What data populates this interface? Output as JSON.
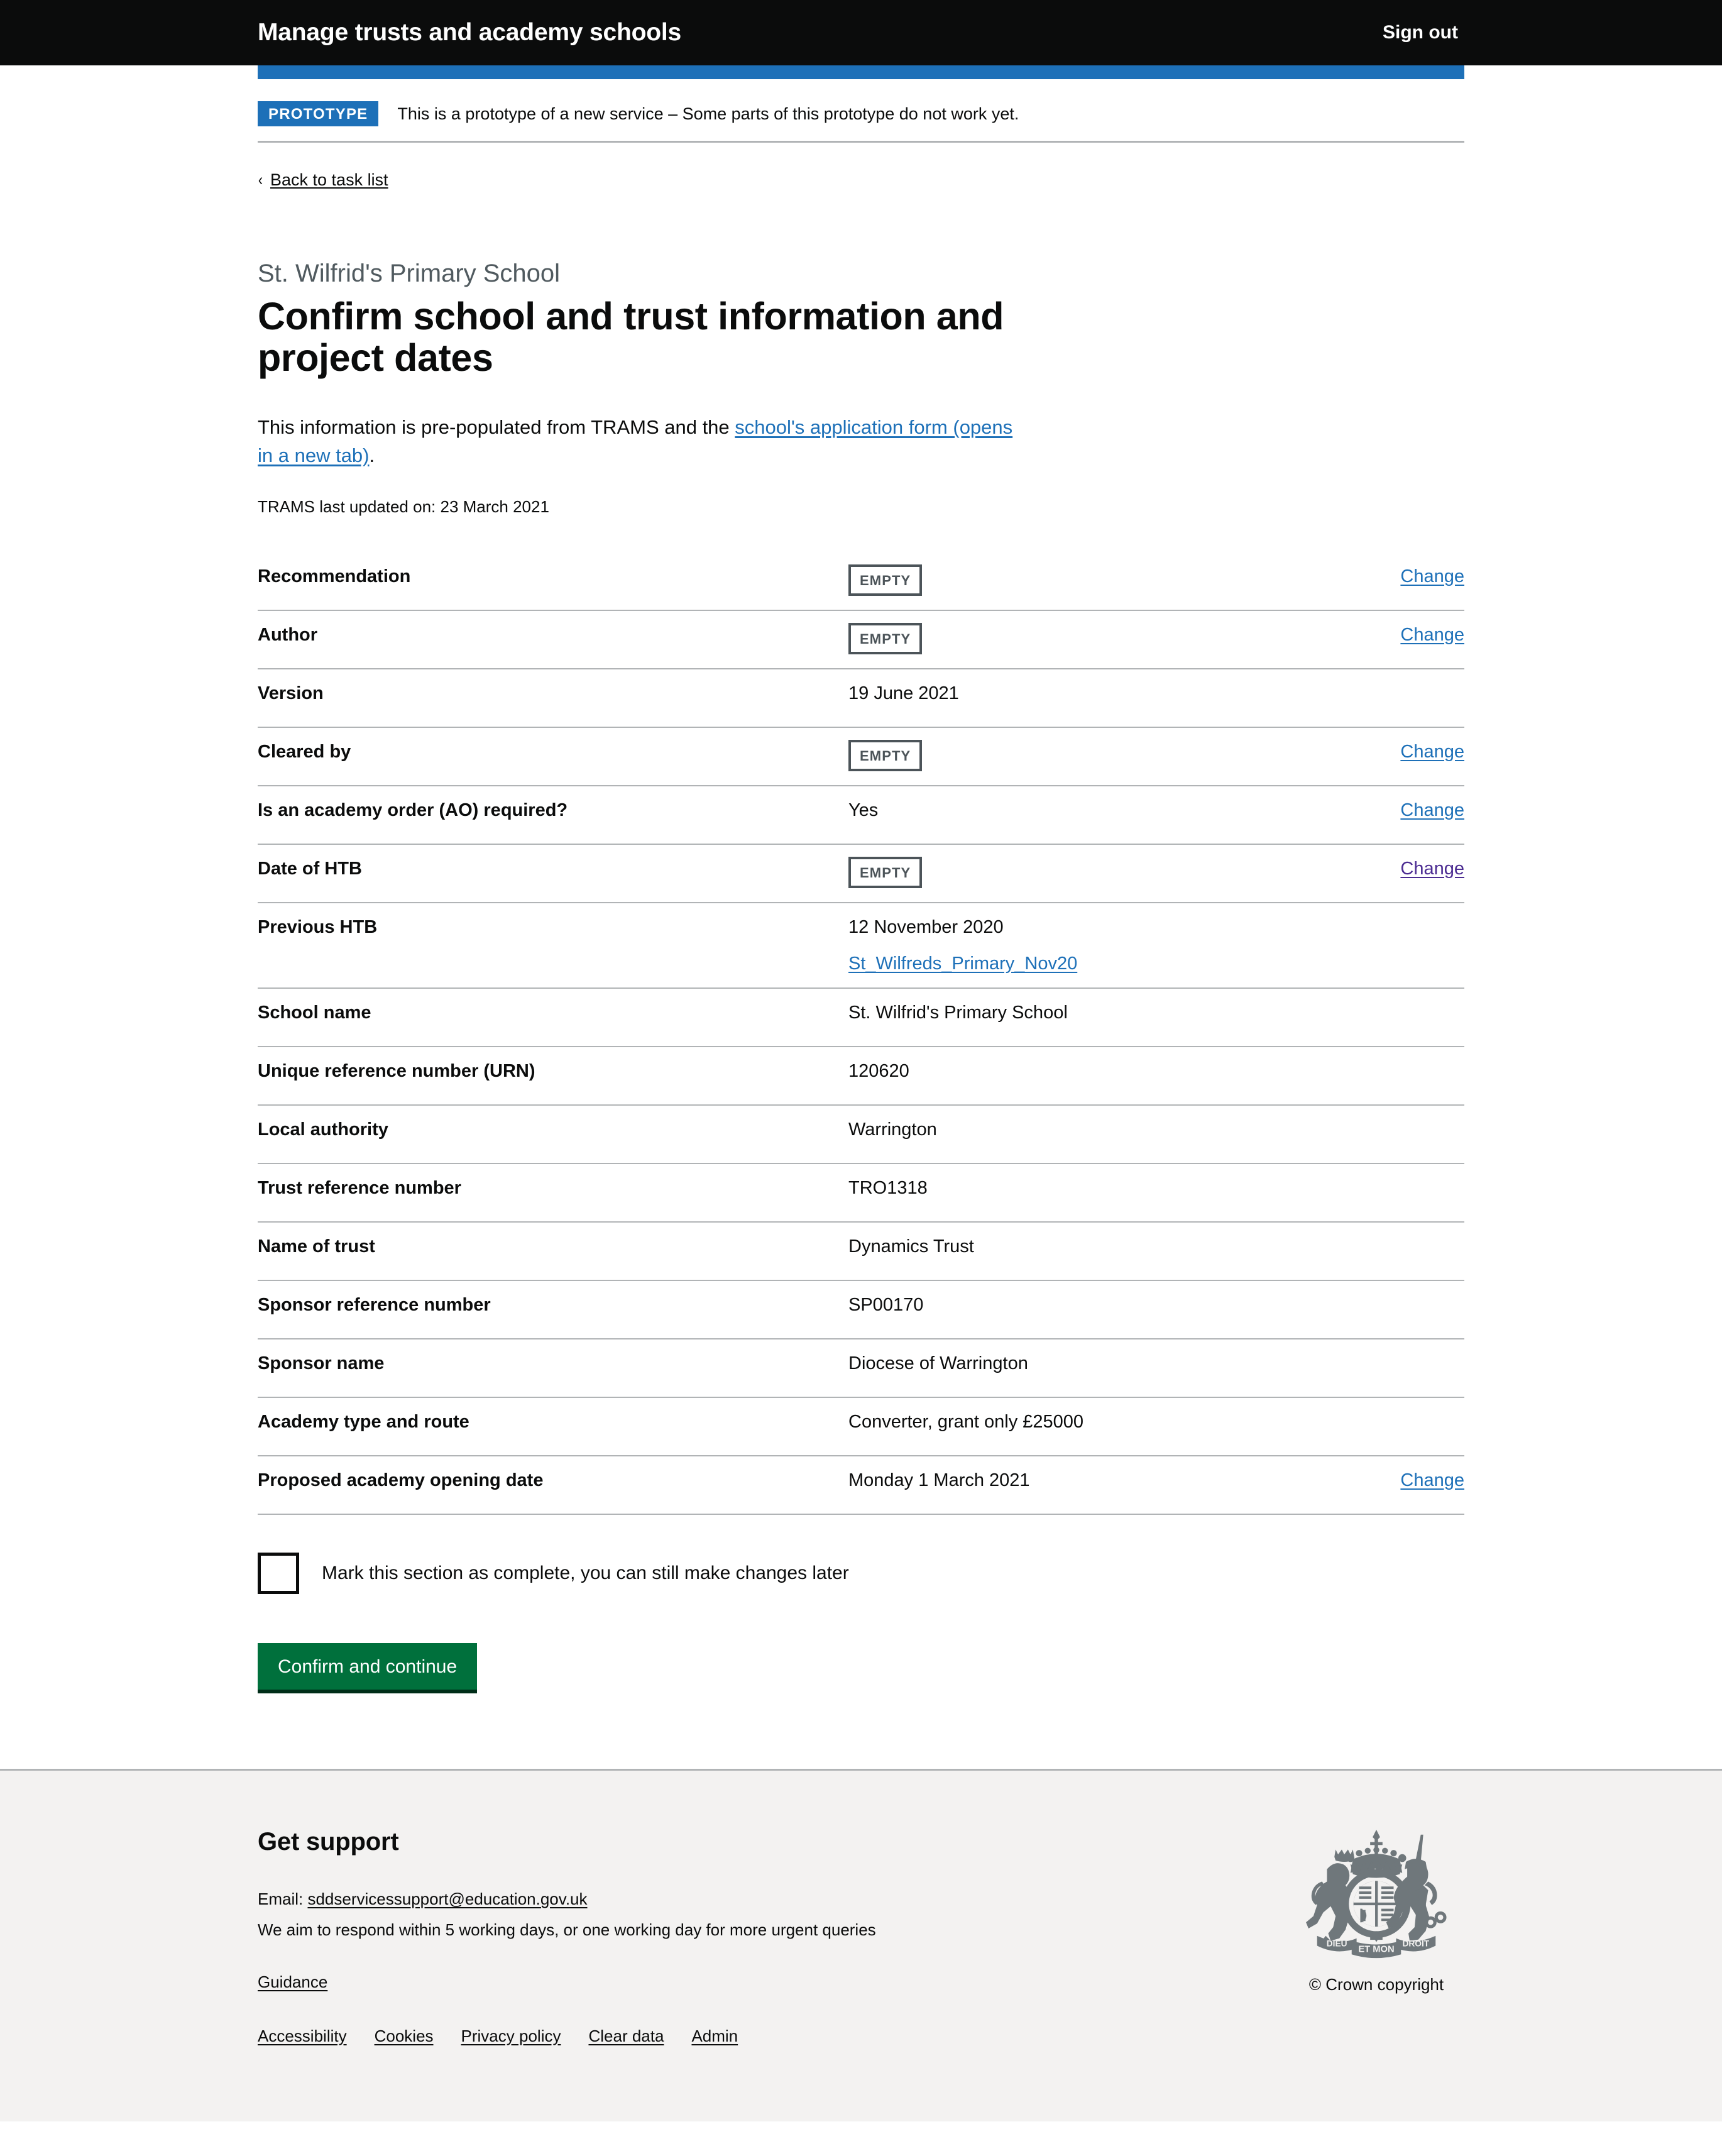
{
  "header": {
    "service_name": "Manage trusts and academy schools",
    "sign_out_label": "Sign out"
  },
  "phase_banner": {
    "tag": "PROTOTYPE",
    "text": "This is a prototype of a new service – Some parts of this prototype do not work yet."
  },
  "back_link": {
    "label": "Back to task list",
    "chevron": "chevron-left-icon"
  },
  "page": {
    "caption": "St. Wilfrid's Primary School",
    "title": "Confirm school and trust information and project dates",
    "lede_prefix": "This information is pre-populated from TRAMS and the ",
    "lede_link": "school's application form (opens in a new tab)",
    "lede_suffix": ".",
    "trams_updated": "TRAMS last updated on: 23 March 2021"
  },
  "summary_list": {
    "empty_tag_label": "EMPTY",
    "change_label": "Change",
    "rows": [
      {
        "key": "Recommendation",
        "value": "",
        "empty": true,
        "action": "Change",
        "visited": false
      },
      {
        "key": "Author",
        "value": "",
        "empty": true,
        "action": "Change",
        "visited": false
      },
      {
        "key": "Version",
        "value": "19 June 2021",
        "empty": false,
        "action": "",
        "visited": false
      },
      {
        "key": "Cleared by",
        "value": "",
        "empty": true,
        "action": "Change",
        "visited": false
      },
      {
        "key": "Is an academy order (AO) required?",
        "value": "Yes",
        "empty": false,
        "action": "Change",
        "visited": false
      },
      {
        "key": "Date of HTB",
        "value": "",
        "empty": true,
        "action": "Change",
        "visited": true
      },
      {
        "key": "Previous HTB",
        "value": "12 November 2020",
        "doc_link": "St_Wilfreds_Primary_Nov20",
        "empty": false,
        "action": "",
        "visited": false
      },
      {
        "key": "School name",
        "value": "St. Wilfrid's Primary School",
        "empty": false,
        "action": "",
        "visited": false
      },
      {
        "key": "Unique reference number (URN)",
        "value": "120620",
        "empty": false,
        "action": "",
        "visited": false
      },
      {
        "key": "Local authority",
        "value": "Warrington",
        "empty": false,
        "action": "",
        "visited": false
      },
      {
        "key": "Trust reference number",
        "value": "TRO1318",
        "empty": false,
        "action": "",
        "visited": false
      },
      {
        "key": "Name of trust",
        "value": "Dynamics Trust",
        "empty": false,
        "action": "",
        "visited": false
      },
      {
        "key": "Sponsor reference number",
        "value": "SP00170",
        "empty": false,
        "action": "",
        "visited": false
      },
      {
        "key": "Sponsor name",
        "value": "Diocese of Warrington",
        "empty": false,
        "action": "",
        "visited": false
      },
      {
        "key": "Academy type and route",
        "value": "Converter, grant only £25000",
        "empty": false,
        "action": "",
        "visited": false
      },
      {
        "key": "Proposed academy opening date",
        "value": "Monday 1 March 2021",
        "empty": false,
        "action": "Change",
        "visited": false
      }
    ]
  },
  "completion": {
    "checkbox_label": "Mark this section as complete, you can still make changes later",
    "checked": false
  },
  "submit": {
    "label": "Confirm and continue"
  },
  "footer": {
    "heading": "Get support",
    "email_prefix": "Email: ",
    "email_address": "sddservicessupport@education.gov.uk",
    "response_text": "We aim to respond within 5 working days, or one working day for more urgent queries",
    "guidance_label": "Guidance",
    "links": [
      "Accessibility",
      "Cookies",
      "Privacy policy",
      "Clear data",
      "Admin"
    ],
    "crown_icon": "royal-coat-of-arms-icon",
    "copyright": "© Crown copyright"
  },
  "colors": {
    "brand_blue": "#1d70b8",
    "header_black": "#0b0c0c",
    "button_green": "#00703c",
    "visited_purple": "#4c2c92",
    "border_grey": "#b1b4b6",
    "footer_grey": "#f3f2f1",
    "tag_grey": "#4c5459",
    "caption_grey": "#505a5f"
  }
}
